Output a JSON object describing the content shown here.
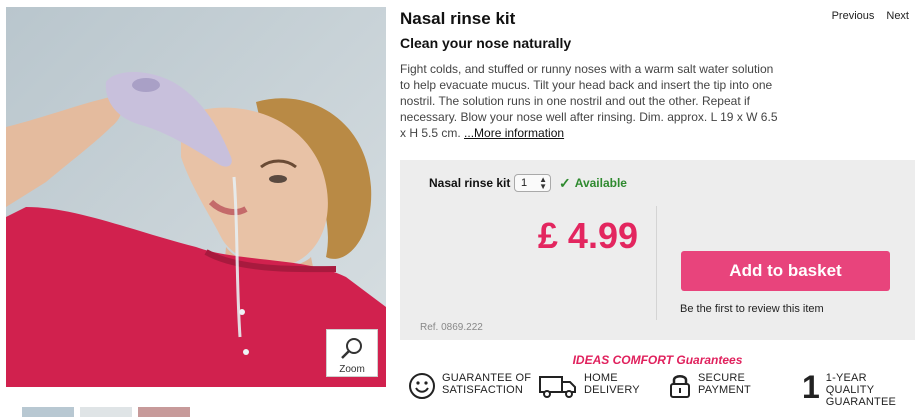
{
  "product": {
    "title": "Nasal rinse kit",
    "subtitle": "Clean your nose naturally",
    "description": "Fight colds, and stuffed or runny noses with a warm salt water solution to help evacuate mucus. Tilt your head back and insert the tip into one nostril. The solution runs in one nostril and out the other. Repeat if necessary. Blow your nose well after rinsing. Dim. approx. L 19 x W 6.5 x H 5.5 cm.",
    "more_link": "...More information"
  },
  "nav": {
    "previous": "Previous",
    "next": "Next"
  },
  "image": {
    "zoom_label": "Zoom",
    "zoom_icon": "magnifier-icon"
  },
  "purchase": {
    "option_label": "Nasal rinse kit",
    "quantity": "1",
    "availability": "Available",
    "price": "£ 4.99",
    "add_button": "Add to basket",
    "review_link": "Be the first to review this item",
    "reference": "Ref. 0869.222"
  },
  "guarantees": {
    "title": "IDEAS COMFORT Guarantees",
    "items": [
      {
        "icon": "smiley-icon",
        "line1": "GUARANTEE OF",
        "line2": "SATISFACTION",
        "line3": ""
      },
      {
        "icon": "delivery-truck-icon",
        "line1": "HOME",
        "line2": "DELIVERY",
        "line3": ""
      },
      {
        "icon": "padlock-icon",
        "line1": "SECURE",
        "line2": "PAYMENT",
        "line3": ""
      },
      {
        "icon": "number-one-icon",
        "glyph": "1",
        "line1": "1-YEAR",
        "line2": "QUALITY",
        "line3": "GUARANTEE"
      }
    ]
  },
  "colors": {
    "price": "#e3265f",
    "button": "#e8447c",
    "available": "#2f8a2f",
    "guarantee_title": "#e0215d"
  }
}
